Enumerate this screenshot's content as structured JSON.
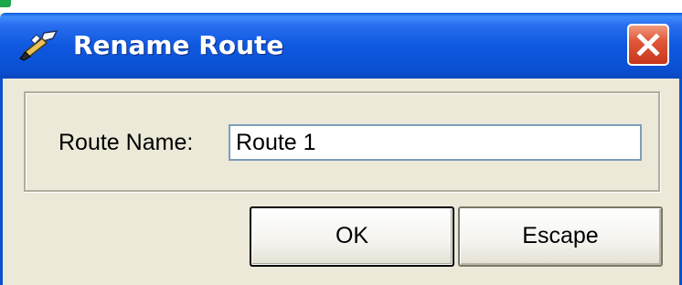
{
  "window": {
    "title": "Rename Route",
    "icon": "paintbrush-icon",
    "close_icon": "close-icon"
  },
  "form": {
    "route_name_label": "Route Name:",
    "route_name_value": "Route 1"
  },
  "buttons": {
    "ok_label": "OK",
    "escape_label": "Escape"
  },
  "colors": {
    "titlebar": "#0b50d2",
    "close_button": "#e0573a",
    "dialog_background": "#ece9d8"
  }
}
